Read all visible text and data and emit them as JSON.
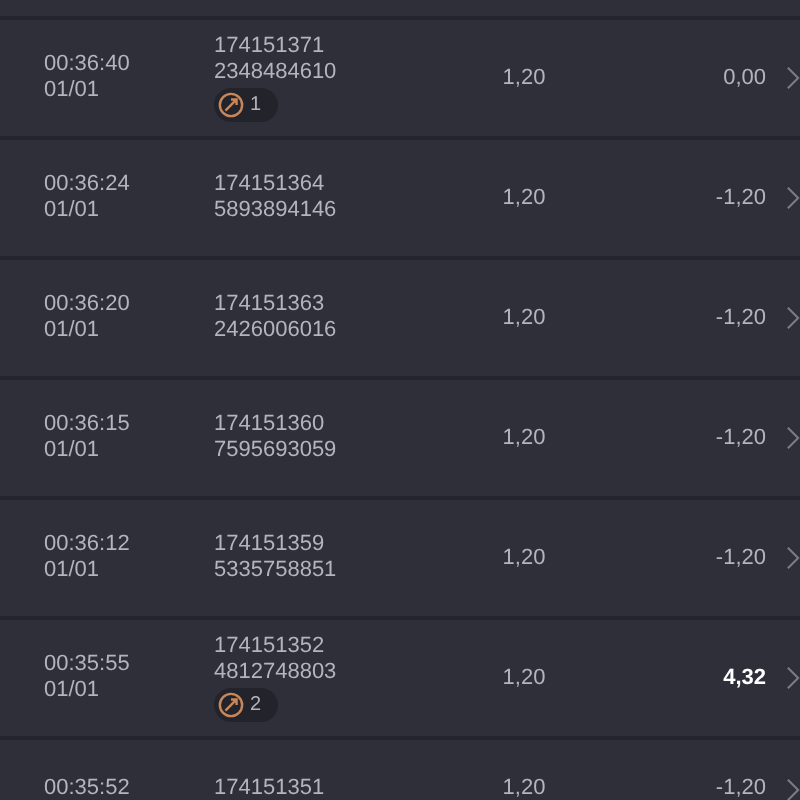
{
  "rows": [
    {
      "time": "00:36:40",
      "date": "01/01",
      "round_id": "174151371",
      "ticket_id": "2348484610",
      "badge": "1",
      "stake": "1,20",
      "result": "0,00",
      "won": false
    },
    {
      "time": "00:36:24",
      "date": "01/01",
      "round_id": "174151364",
      "ticket_id": "5893894146",
      "stake": "1,20",
      "result": "-1,20",
      "won": false
    },
    {
      "time": "00:36:20",
      "date": "01/01",
      "round_id": "174151363",
      "ticket_id": "2426006016",
      "stake": "1,20",
      "result": "-1,20",
      "won": false
    },
    {
      "time": "00:36:15",
      "date": "01/01",
      "round_id": "174151360",
      "ticket_id": "7595693059",
      "stake": "1,20",
      "result": "-1,20",
      "won": false
    },
    {
      "time": "00:36:12",
      "date": "01/01",
      "round_id": "174151359",
      "ticket_id": "5335758851",
      "stake": "1,20",
      "result": "-1,20",
      "won": false
    },
    {
      "time": "00:35:55",
      "date": "01/01",
      "round_id": "174151352",
      "ticket_id": "4812748803",
      "badge": "2",
      "stake": "1,20",
      "result": "4,32",
      "won": true
    },
    {
      "time": "00:35:52",
      "round_id": "174151351",
      "stake": "1,20",
      "result": "-1,20",
      "won": false
    }
  ]
}
